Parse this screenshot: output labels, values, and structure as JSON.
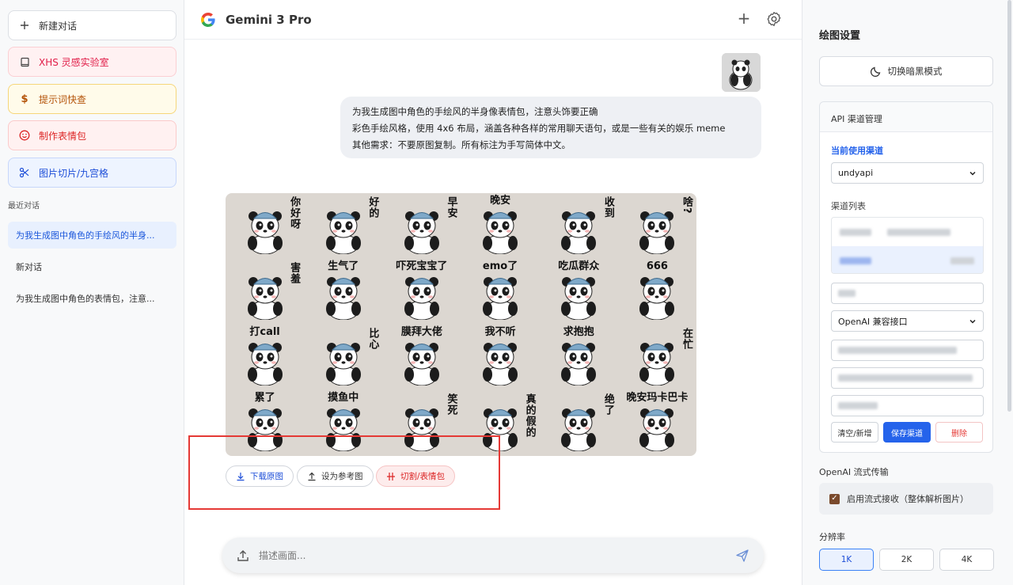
{
  "sidebar": {
    "buttons": [
      {
        "label": "新建对话",
        "icon": "plus-icon"
      },
      {
        "label": "XHS 灵感实验室",
        "icon": "book-icon"
      },
      {
        "label": "提示词快查",
        "icon": "dollar-icon"
      },
      {
        "label": "制作表情包",
        "icon": "smile-icon"
      },
      {
        "label": "图片切片/九宫格",
        "icon": "scissors-icon"
      }
    ],
    "recent_label": "最近对话",
    "history": [
      {
        "label": "为我生成图中角色的手绘风的半身...",
        "active": true
      },
      {
        "label": "新对话",
        "active": false
      },
      {
        "label": "为我生成图中角色的表情包，注意...",
        "active": false
      }
    ]
  },
  "header": {
    "model": "Gemini 3 Pro"
  },
  "chat": {
    "user_message_lines": [
      "为我生成图中角色的手绘风的半身像表情包，注意头饰要正确",
      "彩色手绘风格，使用 4x6 布局，涵盖各种各样的常用聊天语句，或是一些有关的娱乐 meme",
      "其他需求：不要原图复制。所有标注为手写简体中文。"
    ],
    "stickers": [
      {
        "text": "你好呀",
        "vertical": true
      },
      {
        "text": "好的",
        "vertical": true
      },
      {
        "text": "早安",
        "vertical": true
      },
      {
        "text": "晚安",
        "vertical": false
      },
      {
        "text": "收到",
        "vertical": true
      },
      {
        "text": "啥?",
        "vertical": true
      },
      {
        "text": "害羞",
        "vertical": true
      },
      {
        "text": "生气了",
        "vertical": false
      },
      {
        "text": "吓死宝宝了",
        "vertical": false
      },
      {
        "text": "emo了",
        "vertical": false
      },
      {
        "text": "吃瓜群众",
        "vertical": false
      },
      {
        "text": "666",
        "vertical": false
      },
      {
        "text": "打call",
        "vertical": false
      },
      {
        "text": "比心",
        "vertical": true
      },
      {
        "text": "膜拜大佬",
        "vertical": false
      },
      {
        "text": "我不听",
        "vertical": false
      },
      {
        "text": "求抱抱",
        "vertical": false
      },
      {
        "text": "在忙",
        "vertical": true
      },
      {
        "text": "累了",
        "vertical": false
      },
      {
        "text": "摸鱼中",
        "vertical": false
      },
      {
        "text": "笑死",
        "vertical": true
      },
      {
        "text": "真的假的",
        "vertical": true
      },
      {
        "text": "绝了",
        "vertical": true
      },
      {
        "text": "晚安玛卡巴卡",
        "vertical": false
      }
    ],
    "actions": {
      "download": "下载原图",
      "set_reference": "设为参考图",
      "cut_sticker": "切割/表情包"
    }
  },
  "composer": {
    "placeholder": "描述画面..."
  },
  "settings": {
    "title": "绘图设置",
    "dark_mode_button": "切换暗黑模式",
    "api_section_title": "API 渠道管理",
    "current_channel_label": "当前使用渠道",
    "current_channel_value": "undyapi",
    "channel_list_label": "渠道列表",
    "api_type_value": "OpenAI 兼容接口",
    "clear_button": "清空/新增",
    "save_button": "保存渠道",
    "delete_button": "删除",
    "stream_section_label": "OpenAI 流式传输",
    "stream_checkbox_label": "启用流式接收（整体解析图片）",
    "stream_checked": true,
    "resolution_label": "分辨率",
    "resolutions": [
      "1K",
      "2K",
      "4K"
    ],
    "resolution_selected": "1K"
  },
  "colors": {
    "accent": "#2563eb",
    "danger": "#e53935",
    "sticker_bg": "#dcd7d1",
    "panda_hat": "#7fa9c9"
  }
}
